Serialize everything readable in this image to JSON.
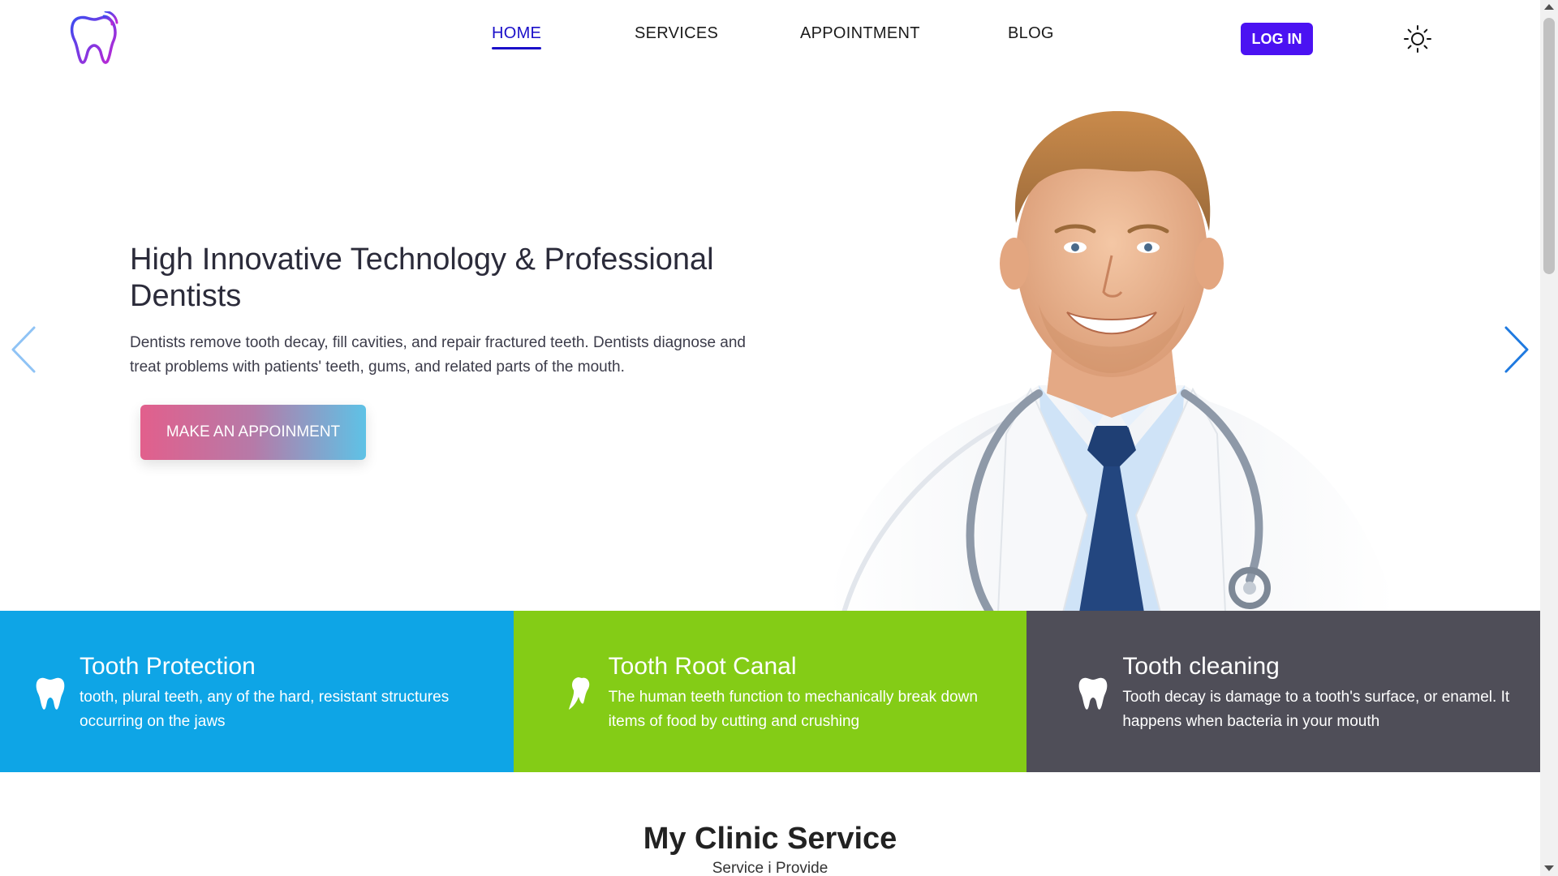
{
  "nav": {
    "items": [
      {
        "label": "HOME",
        "active": true
      },
      {
        "label": "SERVICES",
        "active": false
      },
      {
        "label": "APPOINTMENT",
        "active": false
      },
      {
        "label": "BLOG",
        "active": false
      }
    ],
    "login_label": "LOG IN",
    "login_color": "#4b12f2",
    "active_color": "#1a0fc9",
    "logo_icon": "tooth-logo-icon",
    "theme_icon": "sun-icon"
  },
  "hero": {
    "title": "High Innovative Technology & Professional Dentists",
    "text": "Dentists remove tooth decay, fill cavities, and repair fractured teeth. Dentists diagnose and treat problems with patients' teeth, gums, and related parts of the mouth.",
    "cta_label": "MAKE AN APPOINMENT",
    "cta_gradient": [
      "#e25f8c",
      "#5ec2e6"
    ]
  },
  "features": [
    {
      "title": "Tooth Protection",
      "text": "tooth, plural teeth, any of the hard, resistant structures occurring on the jaws",
      "color": "#0ea5e6",
      "icon": "tooth-icon"
    },
    {
      "title": "Tooth Root Canal",
      "text": "The human teeth function to mechanically break down items of food by cutting and crushing",
      "color": "#84cc16",
      "icon": "tooth-root-icon"
    },
    {
      "title": "Tooth cleaning",
      "text": "Tooth decay is damage to a tooth's surface, or enamel. It happens when bacteria in your mouth",
      "color": "#4f4e58",
      "icon": "tooth-icon"
    }
  ],
  "section": {
    "title": "My Clinic Service",
    "subtitle": "Service i Provide"
  }
}
